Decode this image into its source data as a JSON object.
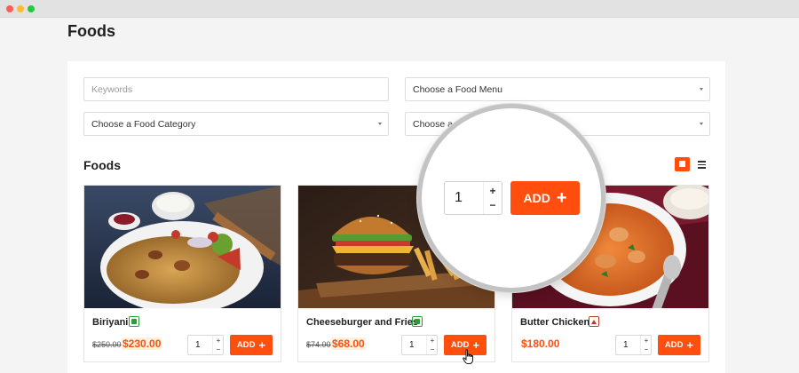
{
  "window": {
    "controls": [
      "close",
      "minimize",
      "maximize"
    ]
  },
  "page": {
    "title": "Foods"
  },
  "filters": {
    "keywords_placeholder": "Keywords",
    "food_menu": "Choose a Food Menu",
    "food_category": "Choose a Food Category",
    "fourth": "Choose a F"
  },
  "section": {
    "title": "Foods",
    "view_modes": [
      "grid-view-icon",
      "list-view-icon"
    ]
  },
  "colors": {
    "accent": "#ff4e0d",
    "veg": "#2a9d3a",
    "nonveg": "#c0392b",
    "price_highlight": "#fff1dc"
  },
  "cards": [
    {
      "name": "Biriyani",
      "diet": "veg",
      "old_price": "$250.00",
      "price": "$230.00",
      "qty": "1",
      "add_label": "ADD"
    },
    {
      "name": "Cheeseburger and Fries",
      "diet": "veg",
      "old_price": "$74.00",
      "price": "$68.00",
      "qty": "1",
      "add_label": "ADD"
    },
    {
      "name": "Butter Chicken",
      "diet": "nonveg",
      "old_price": "",
      "price": "$180.00",
      "qty": "1",
      "add_label": "ADD"
    }
  ],
  "stepper": {
    "plus": "+",
    "minus": "−"
  },
  "magnifier": {
    "qty": "1",
    "add_label": "ADD"
  }
}
